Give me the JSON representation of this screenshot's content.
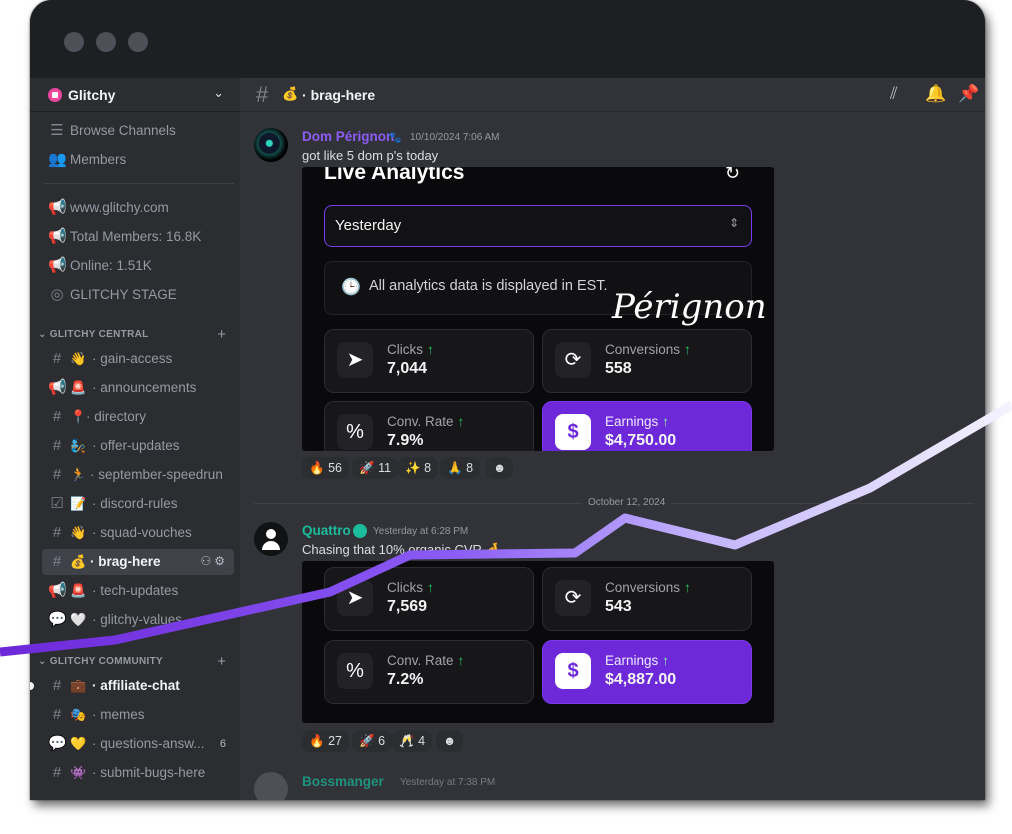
{
  "colors": {
    "accent_purple": "#6d28d9",
    "online_green": "#22c55e",
    "username_purple": "#8c5cf6",
    "username_teal": "#1abc9c"
  },
  "server": {
    "name": "Glitchy"
  },
  "sidebar": {
    "top": [
      {
        "icon": "browse-channels-icon",
        "label": "Browse Channels"
      },
      {
        "icon": "members-icon",
        "label": "Members"
      }
    ],
    "info": [
      {
        "icon": "announcement-icon",
        "label": "www.glitchy.com"
      },
      {
        "icon": "announcement-icon",
        "label": "Total Members: 16.8K"
      },
      {
        "icon": "announcement-icon",
        "label": "Online: 1.51K"
      },
      {
        "icon": "stage-icon",
        "label": "GLITCHY STAGE"
      }
    ],
    "category_central": "GLITCHY CENTRAL",
    "central": [
      {
        "emoji": "👋",
        "label": "gain-access"
      },
      {
        "emoji": "🚨",
        "label": "announcements"
      },
      {
        "emoji": "📍",
        "label": "directory"
      },
      {
        "emoji": "🧞",
        "label": "offer-updates"
      },
      {
        "emoji": "🏃",
        "label": "september-speedrun"
      },
      {
        "emoji": "📝",
        "label": "discord-rules"
      },
      {
        "emoji": "👋",
        "label": "squad-vouches"
      },
      {
        "emoji": "💰",
        "label": "brag-here"
      },
      {
        "emoji": "🚨",
        "label": "tech-updates"
      },
      {
        "emoji": "🤍",
        "label": "glitchy-values"
      }
    ],
    "category_community": "GLITCHY COMMUNITY",
    "community": [
      {
        "emoji": "💼",
        "label": "affiliate-chat",
        "count": ""
      },
      {
        "emoji": "🎭",
        "label": "memes",
        "count": ""
      },
      {
        "emoji": "💛",
        "label": "questions-answ...",
        "count": "6"
      },
      {
        "emoji": "👾",
        "label": "submit-bugs-here",
        "count": ""
      }
    ]
  },
  "channel": {
    "emoji": "💰",
    "name": "brag-here"
  },
  "messages": [
    {
      "author": "Dom Pérignon",
      "timestamp": "10/10/2024 7:06 AM",
      "text": "got like 5 dom p's today",
      "shot": {
        "title": "Live Analytics",
        "select": "Yesterday",
        "notice": "All analytics data is displayed in EST.",
        "watermark": "Pérignon",
        "clicks_label": "Clicks",
        "clicks": "7,044",
        "conv_label": "Conversions",
        "conversions": "558",
        "rate_label": "Conv. Rate",
        "rate": "7.9%",
        "earn_label": "Earnings",
        "earnings": "$4,750.00"
      },
      "reactions": [
        {
          "emoji": "🔥",
          "count": "56"
        },
        {
          "emoji": "🚀",
          "count": "11"
        },
        {
          "emoji": "✨",
          "count": "8"
        },
        {
          "emoji": "🙏",
          "count": "8"
        },
        {
          "emoji": "☻",
          "count": ""
        }
      ]
    },
    {
      "author": "Quattro",
      "timestamp": "Yesterday at 6:28 PM",
      "text": "Chasing that 10% organic CVR 🤞",
      "shot": {
        "clicks_label": "Clicks",
        "clicks": "7,569",
        "conv_label": "Conversions",
        "conversions": "543",
        "rate_label": "Conv. Rate",
        "rate": "7.2%",
        "earn_label": "Earnings",
        "earnings": "$4,887.00"
      },
      "reactions": [
        {
          "emoji": "🔥",
          "count": "27"
        },
        {
          "emoji": "🚀",
          "count": "6"
        },
        {
          "emoji": "🥂",
          "count": "4"
        },
        {
          "emoji": "☻",
          "count": ""
        }
      ]
    },
    {
      "author": "Bossmanger",
      "timestamp": "Yesterday at 7:38 PM"
    }
  ],
  "date_divider": "October 12, 2024"
}
